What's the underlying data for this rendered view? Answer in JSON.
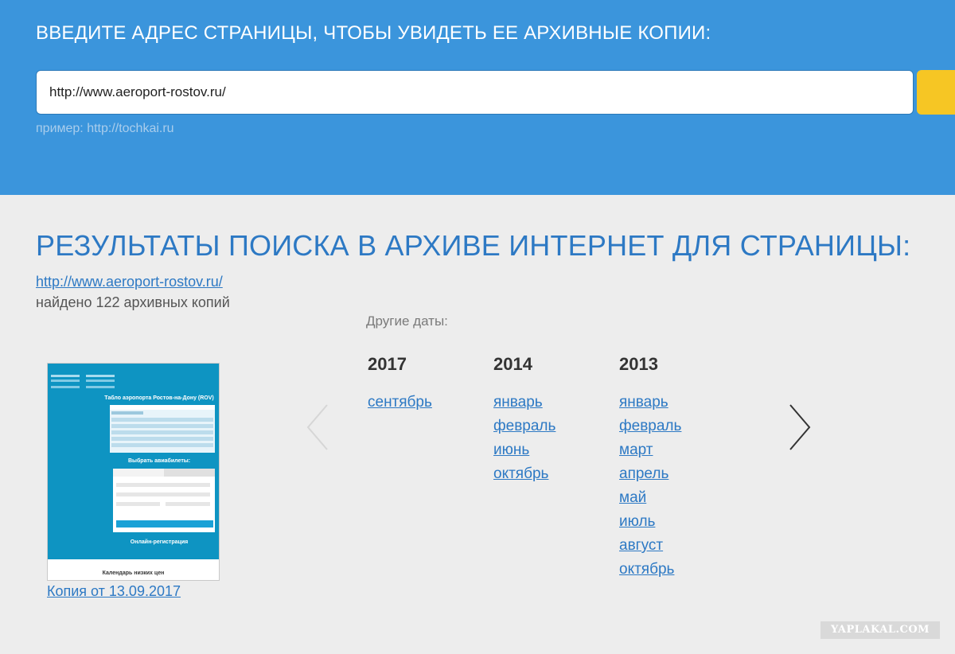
{
  "header": {
    "title": "ВВЕДИТЕ АДРЕС СТРАНИЦЫ, ЧТОБЫ УВИДЕТЬ ЕЕ АРХИВНЫЕ КОПИИ:",
    "url_value": "http://www.aeroport-rostov.ru/",
    "example": "пример: http://tochkai.ru"
  },
  "results": {
    "title": "РЕЗУЛЬТАТЫ ПОИСКА В АРХИВЕ ИНТЕРНЕТ ДЛЯ СТРАНИЦЫ:",
    "url": "http://www.aeroport-rostov.ru/",
    "found": "найдено 122 архивных копий"
  },
  "snapshot": {
    "caption": "Копия от 13.09.2017",
    "preview_title": "Табло аэропорта Ростов-на-Дону (ROV)",
    "preview_tickets": "Выбрать авиабилеты:",
    "preview_checkin": "Онлайн-регистрация",
    "preview_calendar": "Календарь низких цен"
  },
  "dates": {
    "label": "Другие даты:",
    "years": [
      {
        "year": "2017",
        "months": [
          "сентябрь"
        ]
      },
      {
        "year": "2014",
        "months": [
          "январь",
          "февраль",
          "июнь",
          "октябрь"
        ]
      },
      {
        "year": "2013",
        "months": [
          "январь",
          "февраль",
          "март",
          "апрель",
          "май",
          "июль",
          "август",
          "октябрь"
        ]
      }
    ]
  },
  "watermark": "YAPLAKAL.COM",
  "colors": {
    "header_bg": "#3b95dc",
    "accent": "#2d79c4",
    "button": "#f6c624",
    "page_bg": "#ededed"
  },
  "icons": {
    "prev": "chevron-left-icon",
    "next": "chevron-right-icon"
  }
}
